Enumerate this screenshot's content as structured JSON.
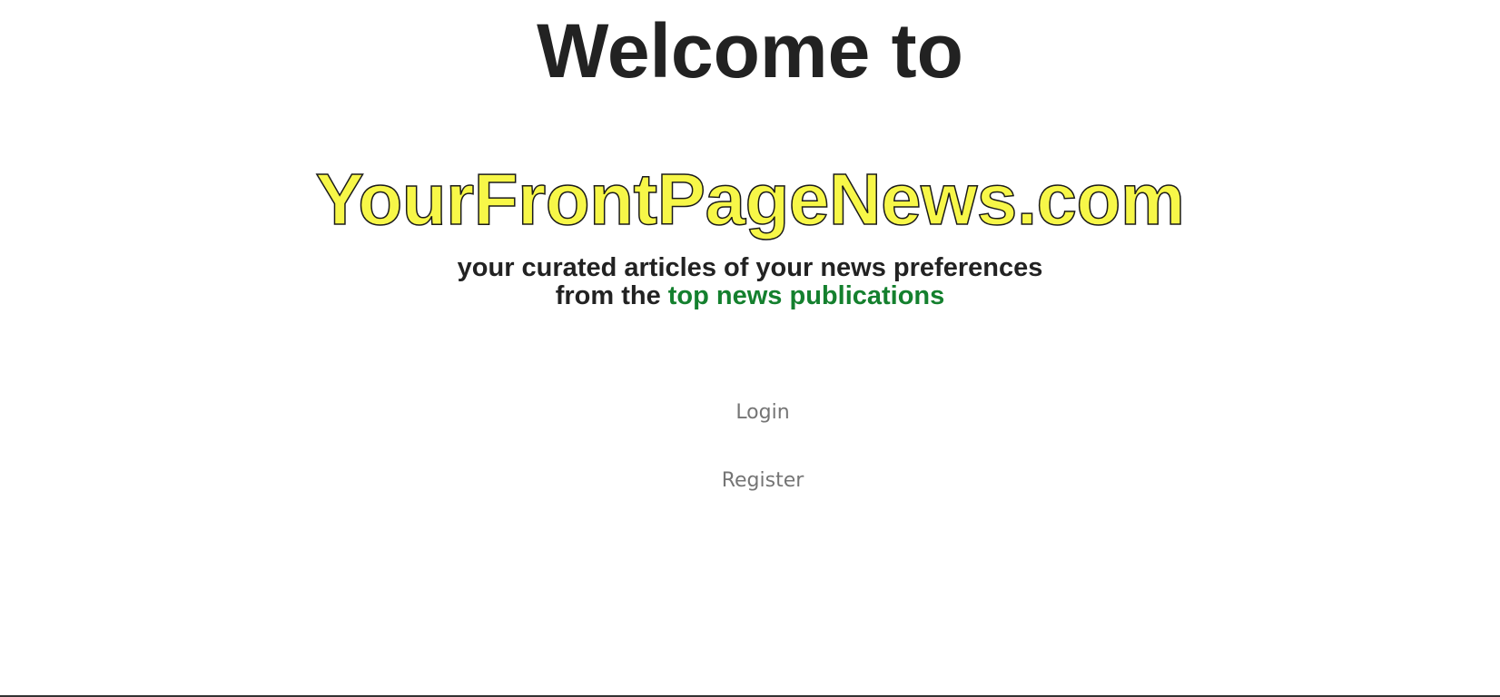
{
  "hero": {
    "welcome": "Welcome to",
    "site_name": "YourFrontPageNews.com",
    "tagline_line1": "your curated articles of your news preferences",
    "tagline_line2_prefix": "from the ",
    "tagline_line2_highlight": "top news publications"
  },
  "nav": {
    "login_label": "Login",
    "register_label": "Register"
  },
  "colors": {
    "site_name_fill": "#f7f748",
    "site_name_outline": "#1a1a1a",
    "highlight": "#14802e",
    "heading_text": "#222222",
    "nav_link": "#757575"
  }
}
